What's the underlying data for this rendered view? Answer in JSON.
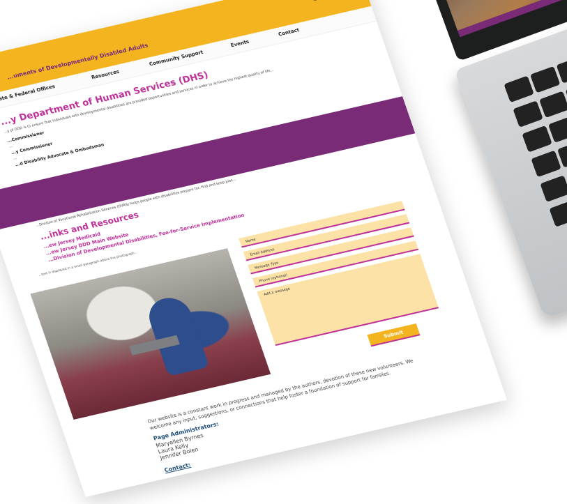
{
  "site": {
    "title": "...uments of Developmentally Disabled Adults",
    "facebook_icon": "facebook-icon"
  },
  "nav": [
    "State & Federal Offices",
    "Resources",
    "Community Support",
    "Events",
    "Contact"
  ],
  "dhs": {
    "heading": "...y Department of Human Services (DHS)",
    "intro": "...y of DDD is to ensure that individuals with developmental disabilities are provided opportunities and services in order to achieve the highest quality of life...",
    "commissioner_label": "...Commissioner",
    "commissioner_email": "...",
    "deputy_label": "...y Commissioner",
    "deputy_email": "...",
    "advocate_label": "...d Disability Advocate & Ombudsman",
    "dvrs_text": "...Division of Vocational Rehabilitation Services (DVRS) helps people with disabilities prepare for, find and keep jobs..."
  },
  "links": {
    "heading": "...inks and Resources",
    "items": [
      "...ew Jersey Medicaid",
      "...ew Jersey DDD Main Website",
      "...Division of Developmental Disabilities, Fee-for-Service Implementation"
    ]
  },
  "photo": {
    "description": "...text is displayed in a small paragraph above the photograph...",
    "credit": "..."
  },
  "form": {
    "name_placeholder": "Name",
    "email_placeholder": "Email Address",
    "message_type_placeholder": "Message Type",
    "phone_placeholder": "Phone (optional)",
    "message_placeholder": "Add a message",
    "submit_label": "Submit"
  },
  "footer": {
    "text": "Our website is a constant work in progress and managed by the authors, devotion of these new volunteers. We welcome any input, suggestions, or connections that help foster a foundation of support for families.",
    "admins_heading": "Page Administrators:",
    "admins": [
      "Maryellen Byrnes",
      "Laura Kelly",
      "Jennifer Bolen"
    ],
    "contact_label": "Contact:"
  },
  "colors": {
    "yellow": "#f3b41f",
    "purple": "#7a2b78",
    "magenta": "#c0309b",
    "form_field": "#fde2a7"
  }
}
